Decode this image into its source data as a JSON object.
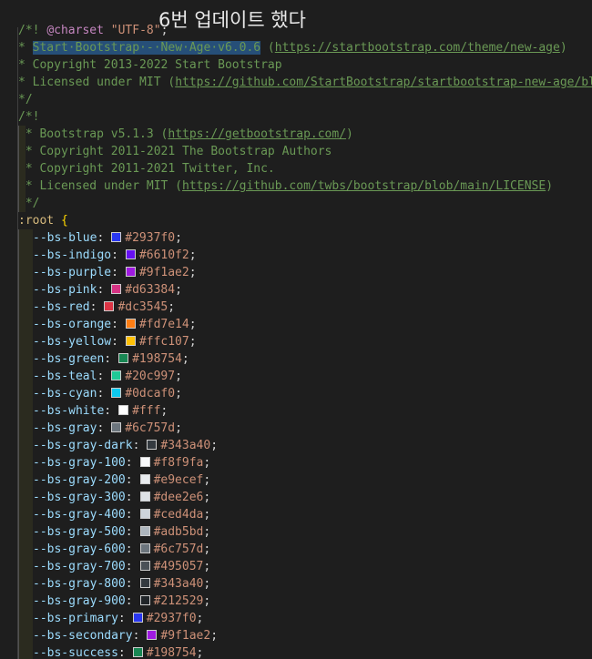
{
  "overlay_text": "6번 업데이트 했다",
  "charset": {
    "keyword": "@charset",
    "value": "\"UTF-8\"",
    "end": ";"
  },
  "header1": {
    "open": "/*!",
    "star": "* ",
    "title": "Start·Bootstrap·-·New·Age·v6.0.6",
    "url1_open": " (",
    "url1": "https://startbootstrap.com/theme/new-age",
    "url1_close": ")",
    "copyright": "* Copyright 2013-2022 Start Bootstrap",
    "license_prefix": "* Licensed under MIT (",
    "license_url": "https://github.com/StartBootstrap/startbootstrap-new-age/blob",
    "close": "*/"
  },
  "header2": {
    "open": "/*!",
    "line1_prefix": " * Bootstrap v5.1.3 (",
    "line1_url": "https://getbootstrap.com/",
    "line1_suffix": ")",
    "line2": " * Copyright 2011-2021 The Bootstrap Authors",
    "line3": " * Copyright 2011-2021 Twitter, Inc.",
    "line4_prefix": " * Licensed under MIT (",
    "line4_url": "https://github.com/twbs/bootstrap/blob/main/LICENSE",
    "line4_suffix": ")",
    "close": " */"
  },
  "root": {
    "selector": ":root",
    "brace": " {"
  },
  "variables": [
    {
      "name": "--bs-blue",
      "value": "#2937f0",
      "color": "#2937f0"
    },
    {
      "name": "--bs-indigo",
      "value": "#6610f2",
      "color": "#6610f2"
    },
    {
      "name": "--bs-purple",
      "value": "#9f1ae2",
      "color": "#9f1ae2"
    },
    {
      "name": "--bs-pink",
      "value": "#d63384",
      "color": "#d63384"
    },
    {
      "name": "--bs-red",
      "value": "#dc3545",
      "color": "#dc3545"
    },
    {
      "name": "--bs-orange",
      "value": "#fd7e14",
      "color": "#fd7e14"
    },
    {
      "name": "--bs-yellow",
      "value": "#ffc107",
      "color": "#ffc107"
    },
    {
      "name": "--bs-green",
      "value": "#198754",
      "color": "#198754"
    },
    {
      "name": "--bs-teal",
      "value": "#20c997",
      "color": "#20c997"
    },
    {
      "name": "--bs-cyan",
      "value": "#0dcaf0",
      "color": "#0dcaf0"
    },
    {
      "name": "--bs-white",
      "value": "#fff",
      "color": "#ffffff"
    },
    {
      "name": "--bs-gray",
      "value": "#6c757d",
      "color": "#6c757d"
    },
    {
      "name": "--bs-gray-dark",
      "value": "#343a40",
      "color": "#343a40"
    },
    {
      "name": "--bs-gray-100",
      "value": "#f8f9fa",
      "color": "#f8f9fa"
    },
    {
      "name": "--bs-gray-200",
      "value": "#e9ecef",
      "color": "#e9ecef"
    },
    {
      "name": "--bs-gray-300",
      "value": "#dee2e6",
      "color": "#dee2e6"
    },
    {
      "name": "--bs-gray-400",
      "value": "#ced4da",
      "color": "#ced4da"
    },
    {
      "name": "--bs-gray-500",
      "value": "#adb5bd",
      "color": "#adb5bd"
    },
    {
      "name": "--bs-gray-600",
      "value": "#6c757d",
      "color": "#6c757d"
    },
    {
      "name": "--bs-gray-700",
      "value": "#495057",
      "color": "#495057"
    },
    {
      "name": "--bs-gray-800",
      "value": "#343a40",
      "color": "#343a40"
    },
    {
      "name": "--bs-gray-900",
      "value": "#212529",
      "color": "#212529"
    },
    {
      "name": "--bs-primary",
      "value": "#2937f0",
      "color": "#2937f0"
    },
    {
      "name": "--bs-secondary",
      "value": "#9f1ae2",
      "color": "#9f1ae2"
    },
    {
      "name": "--bs-success",
      "value": "#198754",
      "color": "#198754"
    }
  ]
}
